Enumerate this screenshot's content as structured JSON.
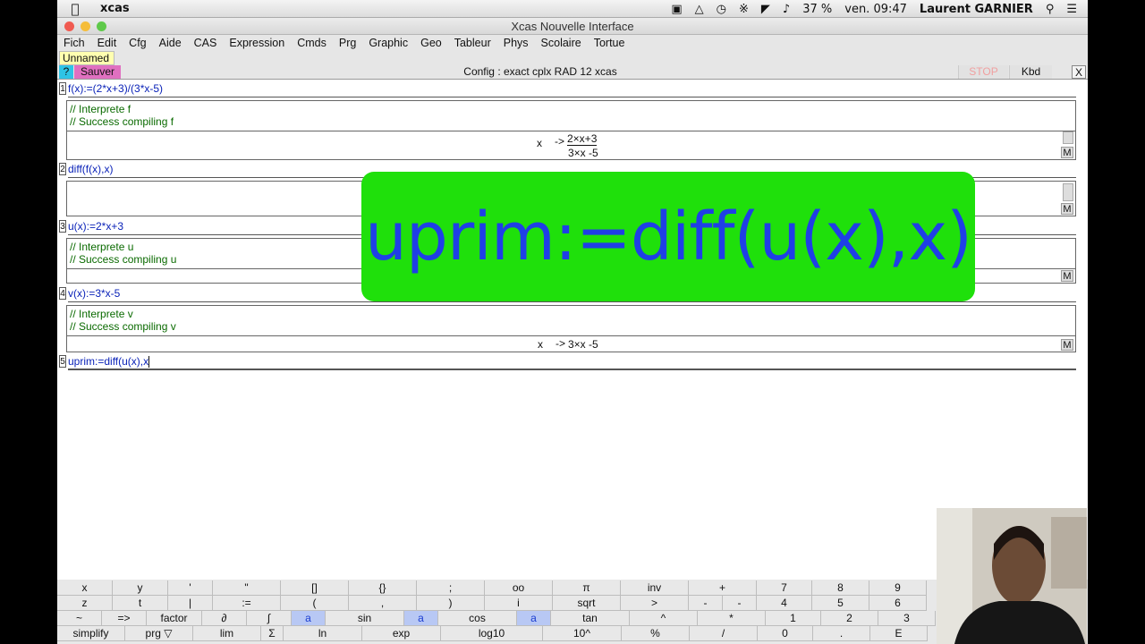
{
  "menubar": {
    "app_name": "xcas",
    "battery": "37 %",
    "clock": "ven. 09:47",
    "user": "Laurent GARNIER"
  },
  "window": {
    "title": "Xcas Nouvelle Interface"
  },
  "app_menu": [
    "Fich",
    "Edit",
    "Cfg",
    "Aide",
    "CAS",
    "Expression",
    "Cmds",
    "Prg",
    "Graphic",
    "Geo",
    "Tableur",
    "Phys",
    "Scolaire",
    "Tortue"
  ],
  "tab": {
    "label": "Unnamed"
  },
  "toolbar": {
    "help": "?",
    "save": "Sauver",
    "config": "Config  : exact cplx RAD 12 xcas",
    "stop": "STOP",
    "kbd": "Kbd",
    "close": "X"
  },
  "levels": [
    {
      "num": "1",
      "cmd": "f(x):=(2*x+3)/(3*x-5)",
      "msg1": "// Interprete f",
      "msg2": "// Success compiling f",
      "out_var": "x",
      "out_arrow": "->",
      "out_num": "2×x+3",
      "out_den": "3×x -5"
    },
    {
      "num": "2",
      "cmd": "diff(f(x),x)"
    },
    {
      "num": "3",
      "cmd": "u(x):=2*x+3",
      "msg1": "// Interprete u",
      "msg2": "// Success compiling u"
    },
    {
      "num": "4",
      "cmd": "v(x):=3*x-5",
      "msg1": "// Interprete v",
      "msg2": "// Success compiling v",
      "out_var": "x",
      "out_arrow": "->",
      "out_expr": "3×x -5"
    },
    {
      "num": "5",
      "cmd": "uprim:=diff(u(x),x"
    }
  ],
  "m_label": "M",
  "overlay": {
    "text": "uprim:=diff(u(x),x)"
  },
  "keypad": {
    "row1": [
      "x",
      "y",
      "'",
      "\"",
      "[]",
      "{}",
      ";",
      "oo",
      "π",
      "inv",
      "+",
      "7",
      "8",
      "9"
    ],
    "row2": [
      "z",
      "t",
      "|",
      ":=",
      "(",
      ",",
      ")",
      "i",
      "sqrt",
      ">",
      "-",
      "-",
      "4",
      "5",
      "6"
    ],
    "row3": [
      "~",
      "=>",
      "factor",
      "∂",
      "∫",
      "a",
      "sin",
      "a",
      "cos",
      "a",
      "tan",
      "^",
      "*",
      "1",
      "2",
      "3"
    ],
    "row4": [
      "simplify",
      "prg ▽",
      "lim",
      "Σ",
      "ln",
      "exp",
      "log10",
      "10^",
      "%",
      "/",
      "0",
      ".",
      "E"
    ]
  },
  "colors": {
    "overlay_bg": "#1fe00b",
    "overlay_text": "#1f3fe6",
    "command_text": "#0a22b8",
    "message_text": "#0a6a00",
    "save_bg": "#e070c0"
  }
}
